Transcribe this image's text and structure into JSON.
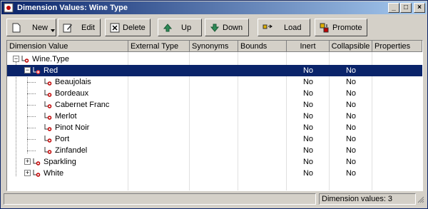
{
  "window": {
    "title": "Dimension Values:  Wine Type"
  },
  "toolbar": {
    "new_label": "New",
    "edit_label": "Edit",
    "delete_label": "Delete",
    "up_label": "Up",
    "down_label": "Down",
    "load_label": "Load",
    "promote_label": "Promote"
  },
  "grid": {
    "columns": [
      "Dimension Value",
      "External Type",
      "Synonyms",
      "Bounds",
      "Inert",
      "Collapsible",
      "Properties"
    ],
    "rows": [
      {
        "label": "Wine.Type",
        "inert": "",
        "collapsible": ""
      },
      {
        "label": "Red",
        "inert": "No",
        "collapsible": "No"
      },
      {
        "label": "Beaujolais",
        "inert": "No",
        "collapsible": "No"
      },
      {
        "label": "Bordeaux",
        "inert": "No",
        "collapsible": "No"
      },
      {
        "label": "Cabernet Franc",
        "inert": "No",
        "collapsible": "No"
      },
      {
        "label": "Merlot",
        "inert": "No",
        "collapsible": "No"
      },
      {
        "label": "Pinot Noir",
        "inert": "No",
        "collapsible": "No"
      },
      {
        "label": "Port",
        "inert": "No",
        "collapsible": "No"
      },
      {
        "label": "Zinfandel",
        "inert": "No",
        "collapsible": "No"
      },
      {
        "label": "Sparkling",
        "inert": "No",
        "collapsible": "No"
      },
      {
        "label": "White",
        "inert": "No",
        "collapsible": "No"
      }
    ]
  },
  "status": {
    "count_text": "Dimension values: 3"
  }
}
